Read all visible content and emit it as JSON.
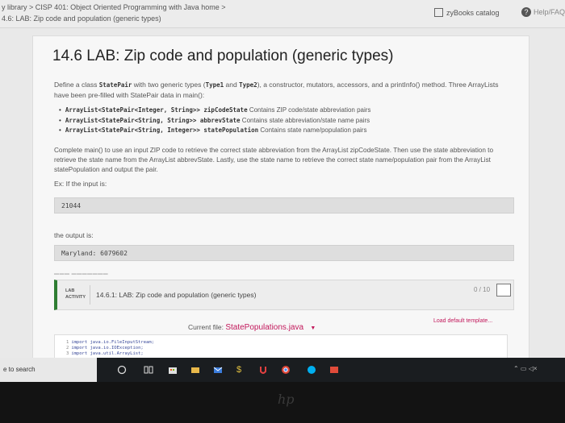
{
  "breadcrumb": {
    "line1": "y library > CISP 401: Object Oriented Programming with Java home >",
    "line2": "4.6: LAB: Zip code and population (generic types)"
  },
  "header": {
    "catalog_label": "zyBooks catalog",
    "help_label": "Help/FAQ"
  },
  "main": {
    "title": "14.6 LAB: Zip code and population (generic types)",
    "intro_a": "Define a class ",
    "intro_class": "StatePair",
    "intro_b": " with two generic types (",
    "intro_t1": "Type1",
    "intro_c": " and ",
    "intro_t2": "Type2",
    "intro_d": "), a constructor, mutators, accessors, and a printInfo() method. Three ArrayLists have been pre-filled with StatePair data in main():",
    "arraylists": [
      {
        "decl": "ArrayList<StatePair<Integer, String>> zipCodeState",
        "desc": "Contains ZIP code/state abbreviation pairs"
      },
      {
        "decl": "ArrayList<StatePair<String, String>> abbrevState",
        "desc": "Contains state abbreviation/state name pairs"
      },
      {
        "decl": "ArrayList<StatePair<String, Integer>> statePopulation",
        "desc": "Contains state name/population pairs"
      }
    ],
    "instructions": "Complete main() to use an input ZIP code to retrieve the correct state abbreviation from the ArrayList zipCodeState. Then use the state abbreviation to retrieve the state name from the ArrayList abbrevState. Lastly, use the state name to retrieve the correct state name/population pair from the ArrayList statePopulation and output the pair.",
    "example_label": "Ex: If the input is:",
    "input_value": "21044",
    "output_label": "the output is:",
    "output_value": "Maryland: 6079602"
  },
  "lab": {
    "tag_line1": "LAB",
    "tag_line2": "ACTIVITY",
    "title": "14.6.1: LAB: Zip code and population (generic types)",
    "score": "0 / 10"
  },
  "editor": {
    "current_file_label": "Current file:",
    "file_name": "StatePopulations.java",
    "load_default": "Load default template...",
    "code_lines": [
      {
        "n": "1",
        "text": "import java.io.FileInputStream;"
      },
      {
        "n": "2",
        "text": "import java.io.IOException;"
      },
      {
        "n": "3",
        "text": "import java.util.ArrayList;"
      }
    ]
  },
  "taskbar": {
    "search_text": "e to search"
  },
  "colors": {
    "accent_pink": "#c2185b",
    "lab_green": "#2e7d32"
  }
}
